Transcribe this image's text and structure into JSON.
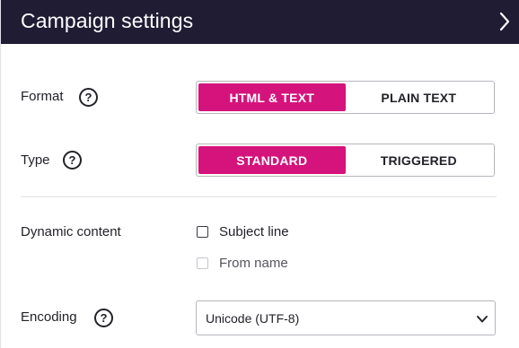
{
  "header": {
    "title": "Campaign settings",
    "close_icon": "chevron-right-icon"
  },
  "format": {
    "label": "Format",
    "help_glyph": "?",
    "options": [
      "HTML & TEXT",
      "PLAIN TEXT"
    ],
    "selected": "HTML & TEXT"
  },
  "type": {
    "label": "Type",
    "help_glyph": "?",
    "options": [
      "STANDARD",
      "TRIGGERED"
    ],
    "selected": "STANDARD"
  },
  "dynamic_content": {
    "label": "Dynamic content",
    "options": [
      {
        "label": "Subject line",
        "checked": false,
        "disabled": false
      },
      {
        "label": "From name",
        "checked": false,
        "disabled": true
      }
    ]
  },
  "encoding": {
    "label": "Encoding",
    "help_glyph": "?",
    "value": "Unicode (UTF-8)"
  },
  "colors": {
    "header_bg": "#1f1c34",
    "accent": "#d5137c",
    "border": "#b6b6be"
  }
}
